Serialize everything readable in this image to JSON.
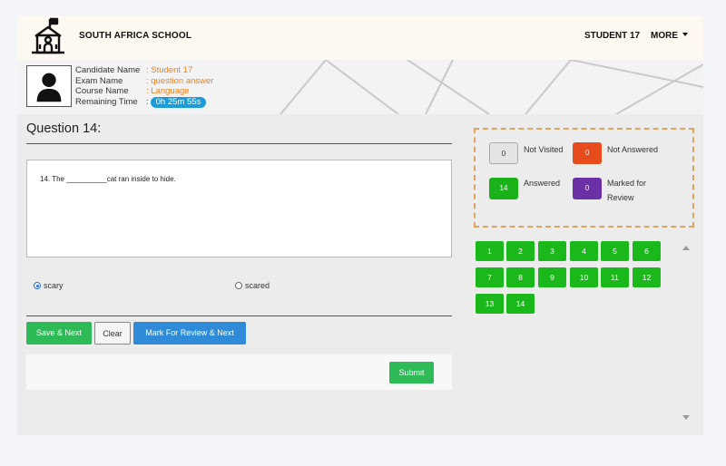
{
  "header": {
    "school_name": "SOUTH AFRICA SCHOOL",
    "user_label": "STUDENT 17",
    "more_label": "MORE"
  },
  "candidate": {
    "name_label": "Candidate Name",
    "name_value": ": Student 17",
    "exam_label": "Exam Name",
    "exam_value": ": question answer",
    "course_label": "Course Name",
    "course_value": ": Language",
    "time_label": "Remaining Time",
    "time_sep": ":",
    "time_value": "0h 25m 55s"
  },
  "question": {
    "title": "Question 14:",
    "text": "14. The __________cat ran inside to hide.",
    "options": [
      {
        "label": "scary",
        "selected": true
      },
      {
        "label": "scared",
        "selected": false
      }
    ]
  },
  "actions": {
    "save_next": "Save & Next",
    "clear": "Clear",
    "mark_review": "Mark For Review & Next",
    "submit": "Submit"
  },
  "legend": {
    "not_visited_count": "0",
    "not_visited_label": "Not Visited",
    "not_answered_count": "0",
    "not_answered_label": "Not Answered",
    "answered_count": "14",
    "answered_label": "Answered",
    "marked_count": "0",
    "marked_label": "Marked for Review"
  },
  "palette": {
    "questions": [
      "1",
      "2",
      "3",
      "4",
      "5",
      "6",
      "7",
      "8",
      "9",
      "10",
      "11",
      "12",
      "13",
      "14"
    ]
  },
  "colors": {
    "answered": "#19b319",
    "not_answered": "#e74c1c",
    "marked": "#6b2fa6",
    "not_visited": "#e4e4e4",
    "accent_orange": "#f07f1b",
    "timer_blue": "#1b9bd8"
  },
  "icons": {
    "logo": "school-building-icon",
    "avatar": "user-silhouette-icon",
    "more": "caret-down-icon"
  }
}
